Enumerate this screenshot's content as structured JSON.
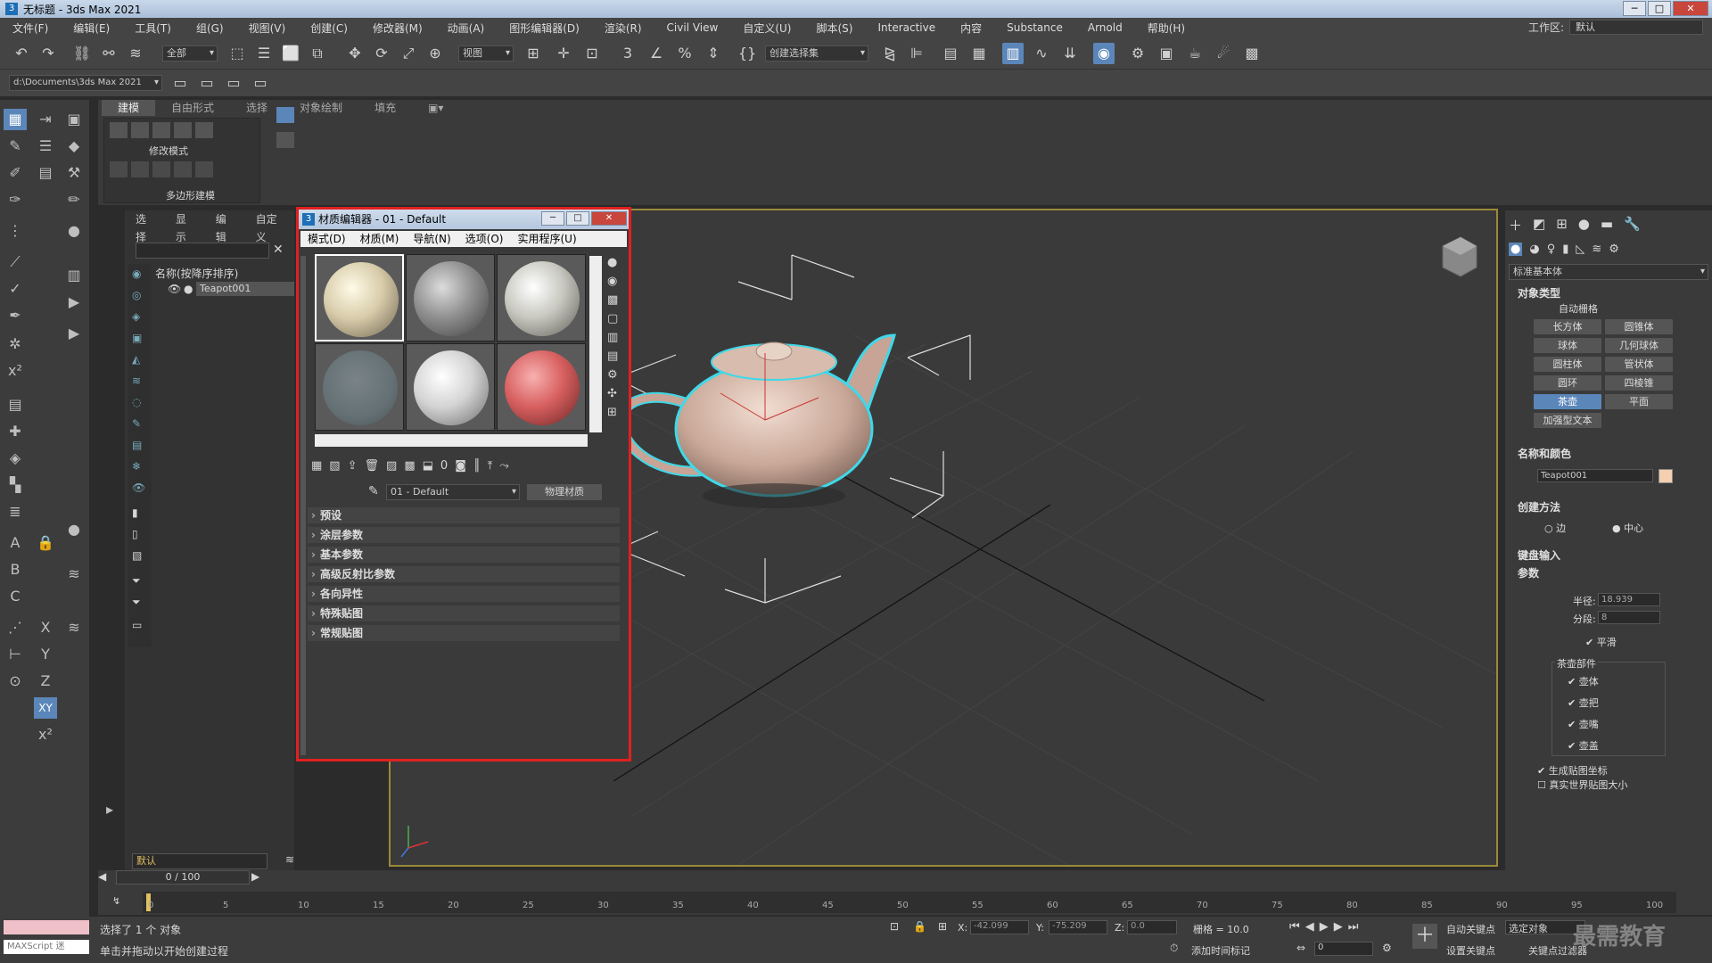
{
  "window": {
    "title": "无标题 - 3ds Max 2021",
    "min": "─",
    "max": "□",
    "close": "✕"
  },
  "menu": [
    "文件(F)",
    "编辑(E)",
    "工具(T)",
    "组(G)",
    "视图(V)",
    "创建(C)",
    "修改器(M)",
    "动画(A)",
    "图形编辑器(D)",
    "渲染(R)",
    "Civil View",
    "自定义(U)",
    "脚本(S)",
    "Interactive",
    "内容",
    "Substance",
    "Arnold",
    "帮助(H)"
  ],
  "workspace": {
    "label": "工作区:",
    "value": "默认"
  },
  "toolbar": {
    "filter": "全部",
    "refcoord": "视图",
    "selset": "创建选择集"
  },
  "path": "d:\\Documents\\3ds Max 2021",
  "ribbon": {
    "tabs": [
      "建模",
      "自由形式",
      "选择",
      "对象绘制",
      "填充"
    ],
    "mode_label": "修改模式",
    "poly_label": "多边形建模"
  },
  "scene": {
    "tabs": [
      "选择",
      "显示",
      "编辑",
      "自定义"
    ],
    "header": "名称(按降序排序)",
    "item": "Teapot001",
    "layer": "默认",
    "frame": "0 / 100"
  },
  "material_editor": {
    "title": "材质编辑器 - 01 - Default",
    "menu": [
      "模式(D)",
      "材质(M)",
      "导航(N)",
      "选项(O)",
      "实用程序(U)"
    ],
    "material_name": "01 - Default",
    "material_type": "物理材质",
    "rollouts": [
      "预设",
      "涂层参数",
      "基本参数",
      "高级反射比参数",
      "各向异性",
      "特殊贴图",
      "常规贴图"
    ]
  },
  "cmd": {
    "dropdown": "标准基本体",
    "object_type": "对象类型",
    "autogrid": "自动栅格",
    "buttons": [
      "长方体",
      "圆锥体",
      "球体",
      "几何球体",
      "圆柱体",
      "管状体",
      "圆环",
      "四棱锥",
      "茶壶",
      "平面",
      "加强型文本"
    ],
    "name_color": "名称和颜色",
    "obj_name": "Teapot001",
    "creation": "创建方法",
    "edge": "边",
    "center": "中心",
    "keyboard": "键盘输入",
    "params": "参数",
    "radius_label": "半径:",
    "radius": "18.939",
    "segs_label": "分段:",
    "segs": "8",
    "smooth": "平滑",
    "parts": "茶壶部件",
    "body": "壶体",
    "handle": "壶把",
    "spout": "壶嘴",
    "lid": "壶盖",
    "genmap": "生成贴图坐标",
    "realworld": "真实世界贴图大小"
  },
  "timeline": {
    "ticks": [
      "0",
      "5",
      "10",
      "15",
      "20",
      "25",
      "30",
      "35",
      "40",
      "45",
      "50",
      "55",
      "60",
      "65",
      "70",
      "75",
      "80",
      "85",
      "90",
      "95",
      "100"
    ]
  },
  "status": {
    "maxscript": "MAXScript 迷",
    "selected": "选择了 1 个 对象",
    "hint": "单击并拖动以开始创建过程",
    "x": "-42.099",
    "y": "-75.209",
    "z": "0.0",
    "grid": "栅格 = 10.0",
    "addtime": "添加时间标记",
    "autokey": "自动关键点",
    "selobj": "选定对象",
    "setkey": "设置关键点",
    "keyfilter": "关键点过滤器",
    "frame": "0",
    "watermark": "最需教育"
  }
}
